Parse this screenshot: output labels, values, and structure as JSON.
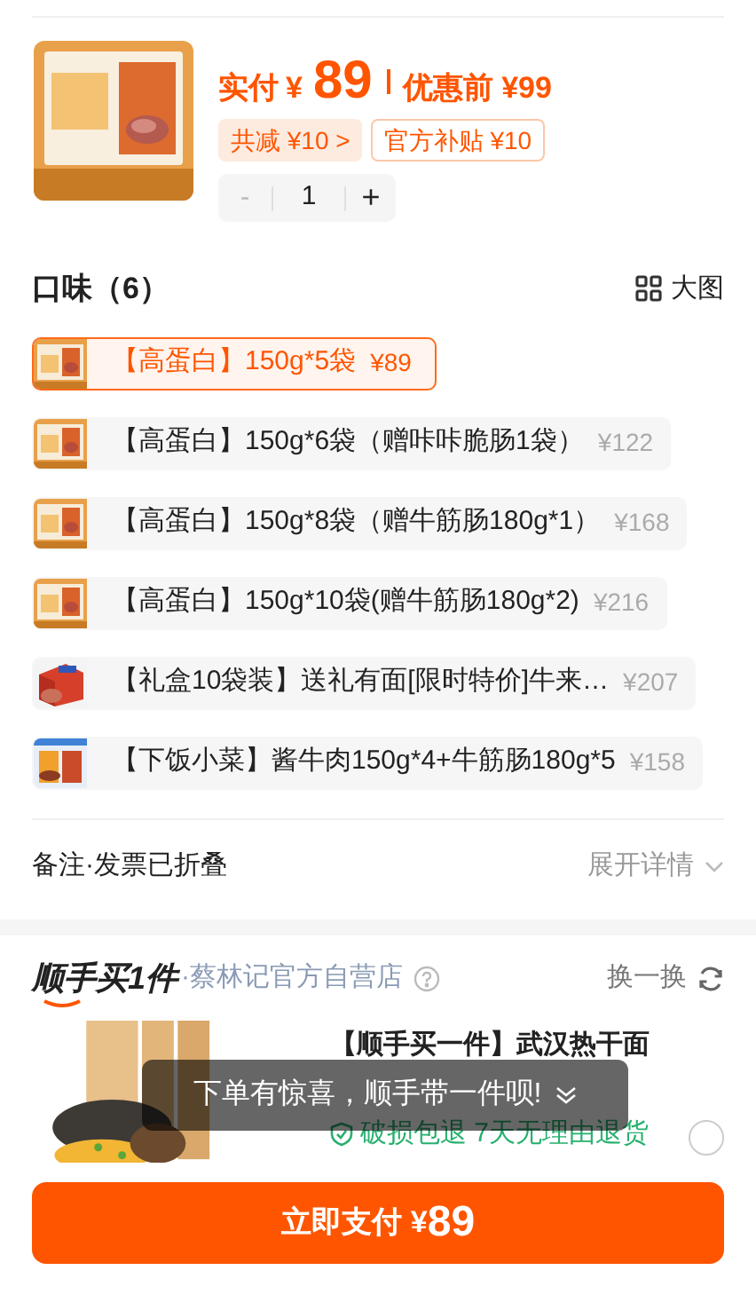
{
  "product": {
    "pay_label": "实付",
    "currency": "¥",
    "price": "89",
    "original_label": "优惠前",
    "original_price": "¥99",
    "discounts": [
      {
        "kind": "total",
        "label": "共减 ¥10 >"
      },
      {
        "kind": "subsidy",
        "label": "官方补贴 ¥10"
      }
    ],
    "quantity": {
      "minus": "-",
      "value": "1",
      "plus": "+",
      "minus_disabled": true
    }
  },
  "flavors": {
    "title": "口味（6）",
    "view_label": "大图",
    "options": [
      {
        "label": "【高蛋白】150g*5袋",
        "price": "¥89",
        "selected": true
      },
      {
        "label": "【高蛋白】150g*6袋（赠咔咔脆肠1袋）",
        "price": "¥122",
        "selected": false
      },
      {
        "label": "【高蛋白】150g*8袋（赠牛筋肠180g*1）",
        "price": "¥168",
        "selected": false
      },
      {
        "label": "【高蛋白】150g*10袋(赠牛筋肠180g*2)",
        "price": "¥216",
        "selected": false
      },
      {
        "label": "【礼盒10袋装】送礼有面[限时特价]牛来…",
        "price": "¥207",
        "selected": false
      },
      {
        "label": "【下饭小菜】酱牛肉150g*4+牛筋肠180g*5",
        "price": "¥158",
        "selected": false
      }
    ]
  },
  "remarks": {
    "label": "备注·发票已折叠",
    "action": "展开详情"
  },
  "bundle": {
    "brand": "顺手买1件",
    "store": "·蔡林记官方自营店",
    "refresh": "换一换",
    "product": {
      "title": "【顺手买一件】武汉热干面",
      "guarantee": "破损包退  7天无理由退货",
      "checked": false
    }
  },
  "toast": "下单有惊喜，顺手带一件呗!",
  "pay_button": {
    "label": "立即支付",
    "currency": "¥",
    "amount": "89"
  }
}
